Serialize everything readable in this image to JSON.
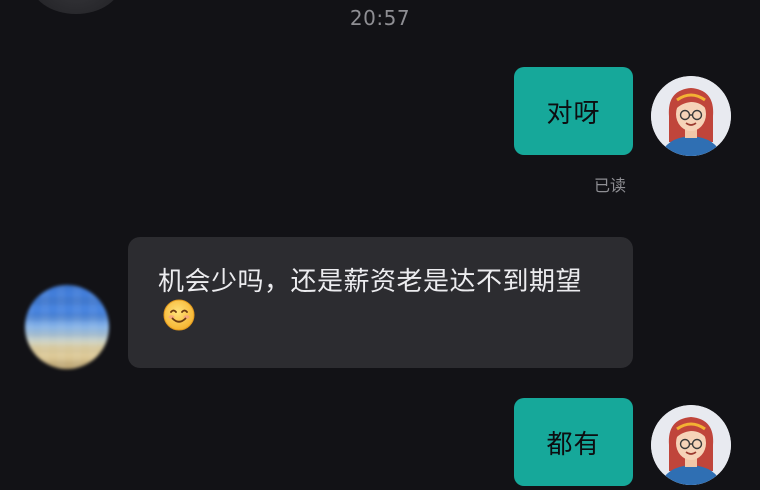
{
  "chat": {
    "timestamp": "20:57",
    "messages": [
      {
        "direction": "outgoing",
        "text": "对呀",
        "status": "已读"
      },
      {
        "direction": "incoming",
        "text": "机会少吗，还是薪资老是达不到期望",
        "emoji": "smiling-face-emoji"
      },
      {
        "direction": "outgoing",
        "text": "都有"
      }
    ]
  },
  "colors": {
    "background": "#121216",
    "outgoing_bubble": "#16a89a",
    "incoming_bubble": "#2c2c30",
    "meta_text": "#8e8e93"
  }
}
